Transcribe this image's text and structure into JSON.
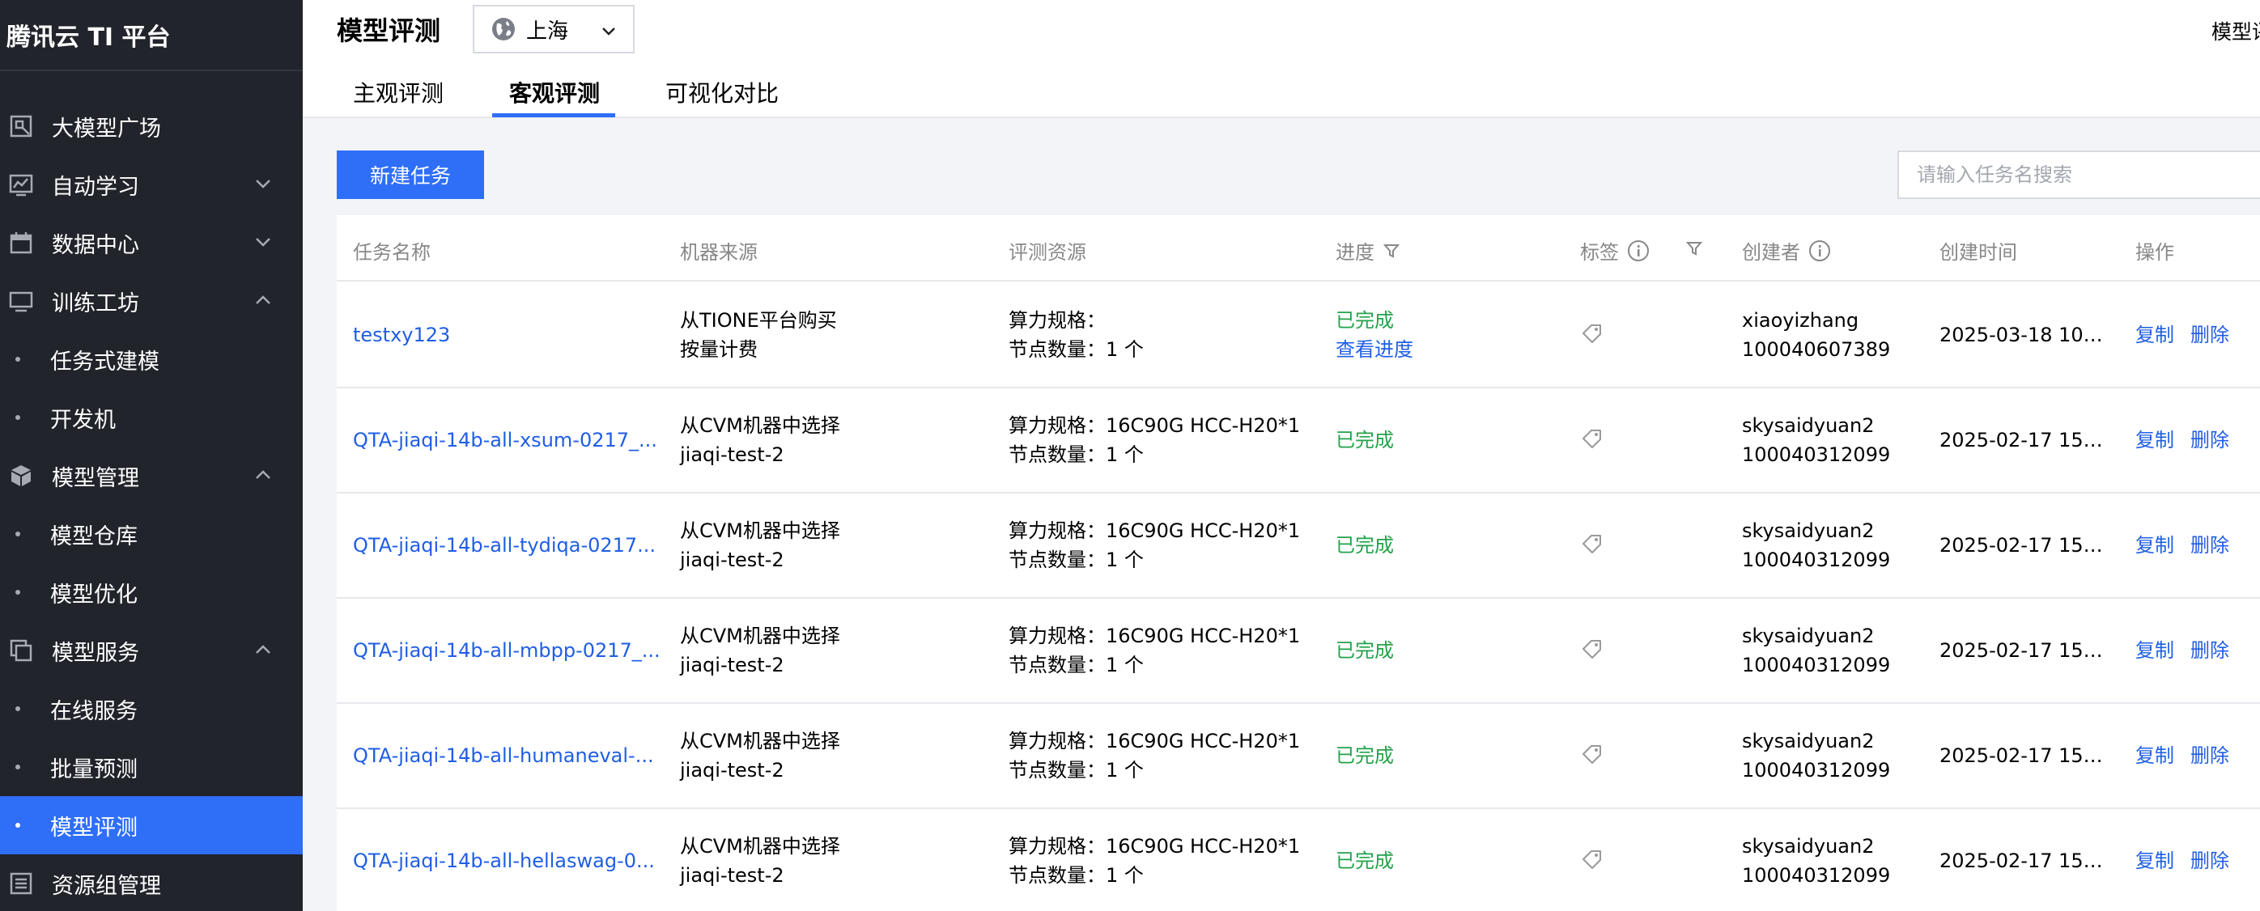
{
  "app": {
    "title": "腾讯云 TI 平台"
  },
  "sidebar": {
    "items": [
      {
        "label": "大模型广场",
        "icon": "model-plaza-icon",
        "type": "top",
        "expand": "none"
      },
      {
        "label": "自动学习",
        "icon": "chart-icon",
        "type": "top",
        "expand": "collapsed"
      },
      {
        "label": "数据中心",
        "icon": "calendar-icon",
        "type": "top",
        "expand": "collapsed"
      },
      {
        "label": "训练工坊",
        "icon": "monitor-icon",
        "type": "top",
        "expand": "expanded"
      },
      {
        "label": "任务式建模",
        "type": "sub"
      },
      {
        "label": "开发机",
        "type": "sub"
      },
      {
        "label": "模型管理",
        "icon": "cube-icon",
        "type": "top",
        "expand": "expanded"
      },
      {
        "label": "模型仓库",
        "type": "sub"
      },
      {
        "label": "模型优化",
        "type": "sub"
      },
      {
        "label": "模型服务",
        "icon": "copy-icon",
        "type": "top",
        "expand": "expanded"
      },
      {
        "label": "在线服务",
        "type": "sub"
      },
      {
        "label": "批量预测",
        "type": "sub"
      },
      {
        "label": "模型评测",
        "type": "sub",
        "active": true
      },
      {
        "label": "资源组管理",
        "icon": "list-icon",
        "type": "top",
        "expand": "none"
      }
    ]
  },
  "header": {
    "title": "模型评测",
    "region": "上海",
    "top_right": "模型评",
    "tabs": [
      {
        "label": "主观评测",
        "active": false
      },
      {
        "label": "客观评测",
        "active": true
      },
      {
        "label": "可视化对比",
        "active": false
      }
    ]
  },
  "toolbar": {
    "new_task": "新建任务",
    "search_placeholder": "请输入任务名搜索"
  },
  "table": {
    "headers": {
      "name": "任务名称",
      "source": "机器来源",
      "resource": "评测资源",
      "progress": "进度",
      "tag": "标签",
      "creator": "创建者",
      "created": "创建时间",
      "ops": "操作"
    },
    "rows": [
      {
        "name": "testxy123",
        "source1": "从TIONE平台购买",
        "source2": "按量计费",
        "res1": "算力规格：",
        "res2": "节点数量：1 个",
        "status": "已完成",
        "progress_link": "查看进度",
        "creator1": "xiaoyizhang",
        "creator2": "100040607389",
        "time": "2025-03-18 10:...",
        "op_copy": "复制",
        "op_delete": "删除"
      },
      {
        "name": "QTA-jiaqi-14b-all-xsum-0217_...",
        "source1": "从CVM机器中选择",
        "source2": "jiaqi-test-2",
        "res1": "算力规格：16C90G HCC-H20*1",
        "res2": "节点数量：1 个",
        "status": "已完成",
        "progress_link": "",
        "creator1": "skysaidyuan2",
        "creator2": "100040312099",
        "time": "2025-02-17 15:...",
        "op_copy": "复制",
        "op_delete": "删除"
      },
      {
        "name": "QTA-jiaqi-14b-all-tydiqa-0217...",
        "source1": "从CVM机器中选择",
        "source2": "jiaqi-test-2",
        "res1": "算力规格：16C90G HCC-H20*1",
        "res2": "节点数量：1 个",
        "status": "已完成",
        "progress_link": "",
        "creator1": "skysaidyuan2",
        "creator2": "100040312099",
        "time": "2025-02-17 15:...",
        "op_copy": "复制",
        "op_delete": "删除"
      },
      {
        "name": "QTA-jiaqi-14b-all-mbpp-0217_...",
        "source1": "从CVM机器中选择",
        "source2": "jiaqi-test-2",
        "res1": "算力规格：16C90G HCC-H20*1",
        "res2": "节点数量：1 个",
        "status": "已完成",
        "progress_link": "",
        "creator1": "skysaidyuan2",
        "creator2": "100040312099",
        "time": "2025-02-17 15:...",
        "op_copy": "复制",
        "op_delete": "删除"
      },
      {
        "name": "QTA-jiaqi-14b-all-humaneval-...",
        "source1": "从CVM机器中选择",
        "source2": "jiaqi-test-2",
        "res1": "算力规格：16C90G HCC-H20*1",
        "res2": "节点数量：1 个",
        "status": "已完成",
        "progress_link": "",
        "creator1": "skysaidyuan2",
        "creator2": "100040312099",
        "time": "2025-02-17 15:...",
        "op_copy": "复制",
        "op_delete": "删除"
      },
      {
        "name": "QTA-jiaqi-14b-all-hellaswag-0...",
        "source1": "从CVM机器中选择",
        "source2": "jiaqi-test-2",
        "res1": "算力规格：16C90G HCC-H20*1",
        "res2": "节点数量：1 个",
        "status": "已完成",
        "progress_link": "",
        "creator1": "skysaidyuan2",
        "creator2": "100040312099",
        "time": "2025-02-17 15:...",
        "op_copy": "复制",
        "op_delete": "删除"
      }
    ]
  },
  "colors": {
    "sidebar_bg": "#21242b",
    "accent": "#2f6ef7",
    "link": "#1f5ee5",
    "success": "#22a34a"
  }
}
